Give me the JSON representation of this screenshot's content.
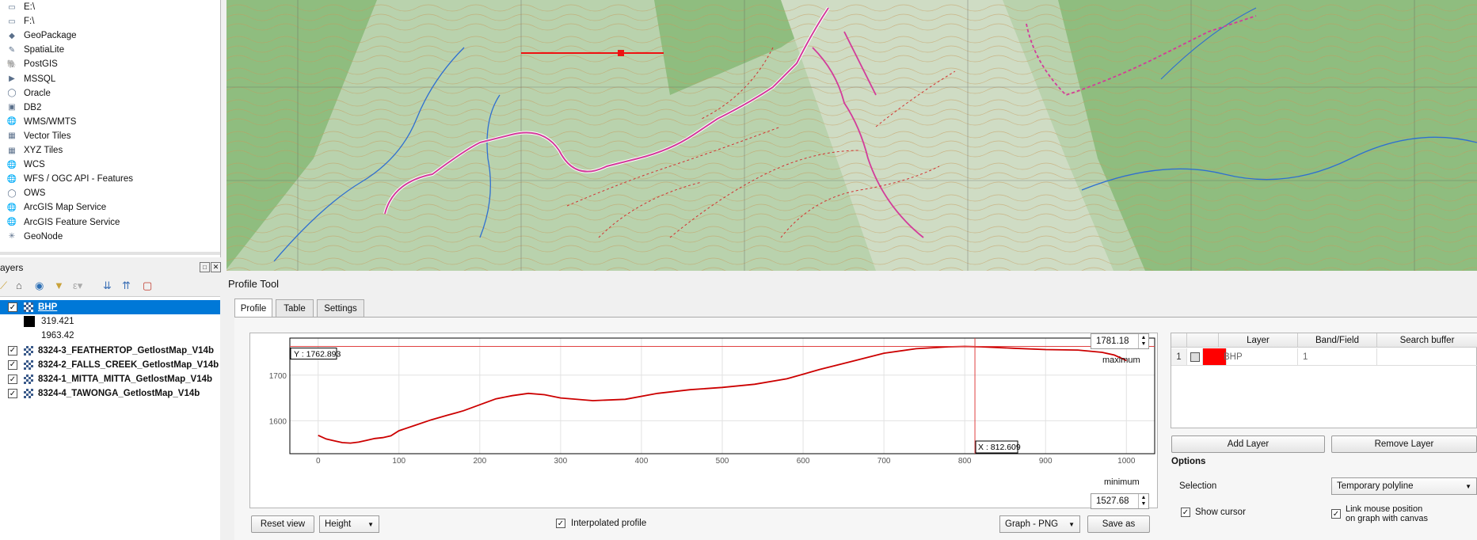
{
  "browser": {
    "items": [
      {
        "label": "E:\\",
        "icon": "drive-icon"
      },
      {
        "label": "F:\\",
        "icon": "drive-icon"
      },
      {
        "label": "GeoPackage",
        "icon": "geopackage-icon"
      },
      {
        "label": "SpatiaLite",
        "icon": "spatialite-icon"
      },
      {
        "label": "PostGIS",
        "icon": "postgis-icon"
      },
      {
        "label": "MSSQL",
        "icon": "mssql-icon"
      },
      {
        "label": "Oracle",
        "icon": "oracle-icon"
      },
      {
        "label": "DB2",
        "icon": "db2-icon"
      },
      {
        "label": "WMS/WMTS",
        "icon": "globe-icon"
      },
      {
        "label": "Vector Tiles",
        "icon": "grid-icon"
      },
      {
        "label": "XYZ Tiles",
        "icon": "grid-icon"
      },
      {
        "label": "WCS",
        "icon": "globe-icon"
      },
      {
        "label": "WFS / OGC API - Features",
        "icon": "globe-icon"
      },
      {
        "label": "OWS",
        "icon": "ows-icon"
      },
      {
        "label": "ArcGIS Map Service",
        "icon": "globe-icon"
      },
      {
        "label": "ArcGIS Feature Service",
        "icon": "globe-icon"
      },
      {
        "label": "GeoNode",
        "icon": "geonode-icon"
      }
    ]
  },
  "layers": {
    "title": "ayers",
    "items": [
      {
        "label": "BHP",
        "checked": true,
        "selected": true
      },
      {
        "label": "319.421",
        "legend": true,
        "swatch": "#000000"
      },
      {
        "label": "1963.42",
        "legend": true
      },
      {
        "label": "8324-3_FEATHERTOP_GetlostMap_V14b",
        "checked": true
      },
      {
        "label": "8324-2_FALLS_CREEK_GetlostMap_V14b",
        "checked": true
      },
      {
        "label": "8324-1_MITTA_MITTA_GetlostMap_V14b",
        "checked": true
      },
      {
        "label": "8324-4_TAWONGA_GetlostMap_V14b",
        "checked": true
      }
    ]
  },
  "profile": {
    "title": "Profile Tool",
    "tabs": [
      "Profile",
      "Table",
      "Settings"
    ],
    "max_value": "1781.18",
    "max_label": "maximum",
    "min_value": "1527.68",
    "min_label": "minimum",
    "cursor_y_label": "Y : 1762.893",
    "cursor_x_label": "X : 812.609",
    "reset_view": "Reset view",
    "mode_select": "Height",
    "interpolated_label": "Interpolated profile",
    "export_format": "Graph - PNG",
    "save_as": "Save as"
  },
  "layer_table": {
    "headers": [
      "",
      "",
      "Layer",
      "Band/Field",
      "Search buffer"
    ],
    "rows": [
      {
        "index": "1",
        "layer": "BHP",
        "band": "1",
        "color": "#ff0000"
      }
    ],
    "add_layer": "Add Layer",
    "remove_layer": "Remove Layer"
  },
  "options": {
    "title": "Options",
    "selection_label": "Selection",
    "selection_value": "Temporary polyline",
    "show_cursor": "Show cursor",
    "link_mouse_line1": "Link mouse position",
    "link_mouse_line2": "on graph with canvas"
  },
  "chart_data": {
    "type": "line",
    "title": "",
    "xlabel": "",
    "ylabel": "",
    "xlim": [
      -35,
      1035
    ],
    "ylim": [
      1527.68,
      1781.18
    ],
    "xticks": [
      0,
      100,
      200,
      300,
      400,
      500,
      600,
      700,
      800,
      900,
      1000
    ],
    "yticks": [
      1600,
      1700
    ],
    "cursor": {
      "x": 812.609,
      "y": 1762.893
    },
    "grid": true,
    "series": [
      {
        "color": "#cc0000",
        "x": [
          0,
          10,
          20,
          30,
          40,
          50,
          60,
          70,
          80,
          90,
          100,
          120,
          140,
          160,
          170,
          180,
          200,
          220,
          240,
          260,
          280,
          300,
          340,
          380,
          420,
          460,
          500,
          540,
          580,
          620,
          660,
          700,
          740,
          780,
          800,
          820,
          860,
          900,
          940,
          970,
          985,
          1000
        ],
        "y": [
          1568,
          1560,
          1556,
          1552,
          1551,
          1553,
          1557,
          1561,
          1563,
          1567,
          1578,
          1590,
          1602,
          1612,
          1617,
          1622,
          1635,
          1648,
          1655,
          1660,
          1657,
          1650,
          1644,
          1647,
          1660,
          1668,
          1673,
          1680,
          1692,
          1712,
          1730,
          1748,
          1758,
          1762,
          1763,
          1762,
          1759,
          1756,
          1755,
          1750,
          1744,
          1732
        ]
      }
    ]
  }
}
